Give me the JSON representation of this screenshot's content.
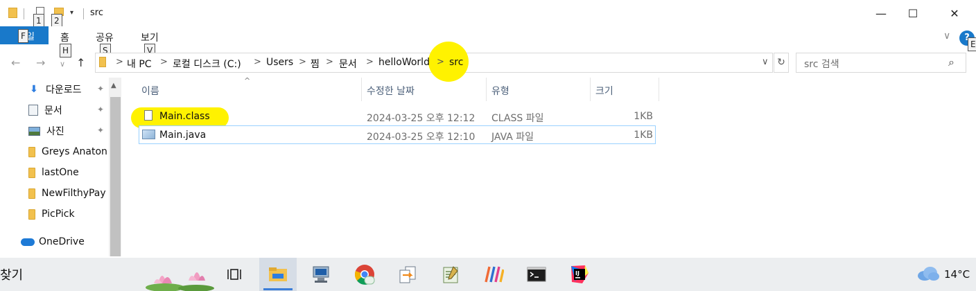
{
  "window": {
    "title": "src",
    "minimize_glyph": "—",
    "maximize_glyph": "☐",
    "close_glyph": "✕"
  },
  "quick_access": {
    "keytip_1": "1",
    "keytip_2": "2",
    "dropdown_glyph": "▾"
  },
  "ribbon": {
    "file_tab": "파일",
    "file_keytip": "F",
    "tabs": [
      {
        "label": "홈",
        "keytip": "H"
      },
      {
        "label": "공유",
        "keytip": "S"
      },
      {
        "label": "보기",
        "keytip": "V"
      }
    ],
    "expand_glyph": "∨",
    "help_glyph": "?",
    "help_keytip": "E"
  },
  "address_bar": {
    "back_glyph": "←",
    "forward_glyph": "→",
    "recent_glyph": "∨",
    "up_glyph": "↑",
    "crumbs": [
      "내 PC",
      "로컬 디스크 (C:)",
      "Users",
      "찜",
      "문서",
      "helloWorld",
      "src"
    ],
    "chevron": ">",
    "dropdown_glyph": "∨",
    "refresh_glyph": "↻"
  },
  "search": {
    "placeholder": "src 검색",
    "icon_glyph": "⌕"
  },
  "nav_pane": {
    "items": [
      {
        "label": "다운로드",
        "icon": "download-icon",
        "pinned": true
      },
      {
        "label": "문서",
        "icon": "document-icon",
        "pinned": true
      },
      {
        "label": "사진",
        "icon": "pictures-icon",
        "pinned": true
      },
      {
        "label": "Greys Anaton",
        "icon": "folder-icon",
        "pinned": false
      },
      {
        "label": "lastOne",
        "icon": "folder-icon",
        "pinned": false
      },
      {
        "label": "NewFilthyPay",
        "icon": "folder-icon",
        "pinned": false
      },
      {
        "label": "PicPick",
        "icon": "folder-icon",
        "pinned": false
      },
      {
        "label": "OneDrive",
        "icon": "onedrive-icon",
        "pinned": false
      }
    ],
    "pin_glyph": "✦"
  },
  "file_list": {
    "columns": [
      "이름",
      "수정한 날짜",
      "유형",
      "크기"
    ],
    "sort_glyph": "^",
    "rows": [
      {
        "name": "Main.class",
        "modified": "2024-03-25 오후 12:12",
        "type": "CLASS 파일",
        "size": "1KB",
        "icon": "class-file-icon"
      },
      {
        "name": "Main.java",
        "modified": "2024-03-25 오후 12:10",
        "type": "JAVA 파일",
        "size": "1KB",
        "icon": "java-file-icon"
      }
    ]
  },
  "taskbar": {
    "search_label": "찾기",
    "apps": [
      "task-view-icon",
      "file-explorer-icon",
      "network-computer-icon",
      "chrome-icon",
      "transfer-icon",
      "notepad-icon",
      "stripes-app-icon",
      "terminal-icon",
      "intellij-icon"
    ],
    "weather_temp": "14°C"
  },
  "colors": {
    "file_tab": "#1979ca",
    "highlight": "#fff200",
    "selection_border": "#99d1ff",
    "column_header_text": "#4c607a",
    "taskbar": "#eceef0"
  }
}
